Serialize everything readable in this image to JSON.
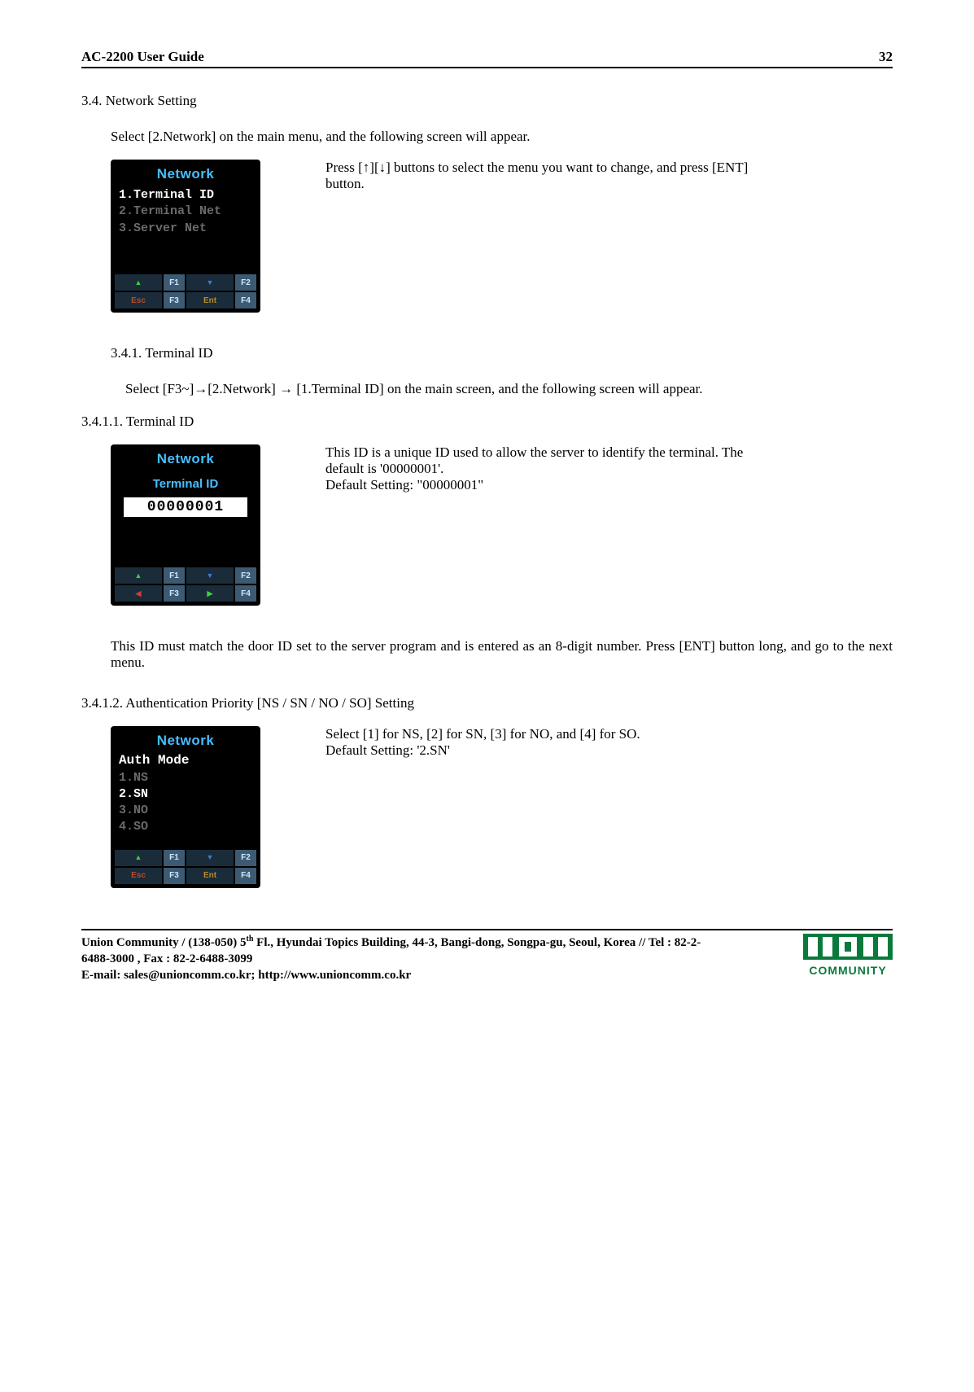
{
  "header": {
    "title": "AC-2200 User Guide",
    "page": "32"
  },
  "s34": {
    "heading": "3.4. Network Setting",
    "intro": "Select [2.Network] on the main menu, and the following screen will appear.",
    "screen": {
      "title": "Network",
      "items": [
        "1.Terminal ID",
        "2.Terminal Net",
        "3.Server Net"
      ],
      "fn": {
        "f1": "F1",
        "f2": "F2",
        "f3": "F3",
        "f4": "F4",
        "esc": "Esc",
        "ent": "Ent"
      }
    },
    "desc": "Press [↑][↓] buttons to select the menu you want to change, and press [ENT] button."
  },
  "s341": {
    "heading": "3.4.1. Terminal ID",
    "intro": "Select [F3~]→[2.Network] → [1.Terminal ID] on the main screen, and the following screen will appear."
  },
  "s3411": {
    "heading": "3.4.1.1. Terminal ID",
    "screen": {
      "title": "Network",
      "sub": "Terminal ID",
      "value": "00000001",
      "fn": {
        "f1": "F1",
        "f2": "F2",
        "f3": "F3",
        "f4": "F4"
      }
    },
    "desc1": "This ID is a unique ID used to allow the server to identify the terminal. The default is '00000001'.",
    "desc2": "Default Setting: \"00000001\"",
    "after": "This ID must match the door ID set to the server program and is entered as an 8-digit number. Press [ENT] button long, and go to the next menu."
  },
  "s3412": {
    "heading": "3.4.1.2. Authentication Priority [NS / SN / NO / SO] Setting",
    "screen": {
      "title": "Network",
      "sub": "Auth Mode",
      "items": [
        "1.NS",
        "2.SN",
        "3.NO",
        "4.SO"
      ],
      "fn": {
        "f1": "F1",
        "f2": "F2",
        "f3": "F3",
        "f4": "F4",
        "esc": "Esc",
        "ent": "Ent"
      }
    },
    "desc1": "Select [1] for NS, [2] for SN, [3] for NO, and [4] for SO.",
    "desc2": "Default Setting: '2.SN'"
  },
  "footer": {
    "line1a": "Union Community / (138-050) 5",
    "line1sup": "th",
    "line1b": " Fl., Hyundai Topics Building, 44-3, Bangi-dong, Songpa-gu, Seoul, Korea // Tel : 82-2-6488-3000 , Fax : 82-2-6488-3099",
    "line2": "E-mail: sales@unioncomm.co.kr; http://www.unioncomm.co.kr",
    "logo_word": "COMMUNITY"
  }
}
